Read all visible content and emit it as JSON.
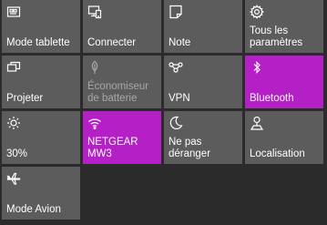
{
  "colors": {
    "background": "#2b2b2b",
    "tile": "#5c5c5c",
    "tile_active": "#b420c6",
    "text": "#ffffff",
    "text_disabled": "#a8a8a8"
  },
  "tiles": [
    {
      "name": "mode-tablette-tile",
      "icon": "tablet-mode-icon",
      "label": "Mode tablette",
      "state": "off"
    },
    {
      "name": "connecter-tile",
      "icon": "connect-icon",
      "label": "Connecter",
      "state": "off"
    },
    {
      "name": "note-tile",
      "icon": "note-icon",
      "label": "Note",
      "state": "off"
    },
    {
      "name": "tous-les-parametres-tile",
      "icon": "gear-icon",
      "label": "Tous les\nparamètres",
      "state": "off"
    },
    {
      "name": "projeter-tile",
      "icon": "project-icon",
      "label": "Projeter",
      "state": "off"
    },
    {
      "name": "economiseur-de-batterie-tile",
      "icon": "battery-saver-icon",
      "label": "Économiseur\nde batterie",
      "state": "disabled"
    },
    {
      "name": "vpn-tile",
      "icon": "vpn-icon",
      "label": "VPN",
      "state": "off"
    },
    {
      "name": "bluetooth-tile",
      "icon": "bluetooth-icon",
      "label": "Bluetooth",
      "state": "on"
    },
    {
      "name": "brightness-tile",
      "icon": "brightness-icon",
      "label": "30%",
      "state": "off"
    },
    {
      "name": "wifi-tile",
      "icon": "wifi-icon",
      "label": "NETGEAR\nMW3",
      "state": "on"
    },
    {
      "name": "ne-pas-deranger-tile",
      "icon": "moon-icon",
      "label": "Ne pas\ndéranger",
      "state": "off"
    },
    {
      "name": "localisation-tile",
      "icon": "location-icon",
      "label": "Localisation",
      "state": "off"
    },
    {
      "name": "mode-avion-tile",
      "icon": "airplane-icon",
      "label": "Mode Avion",
      "state": "off"
    }
  ]
}
